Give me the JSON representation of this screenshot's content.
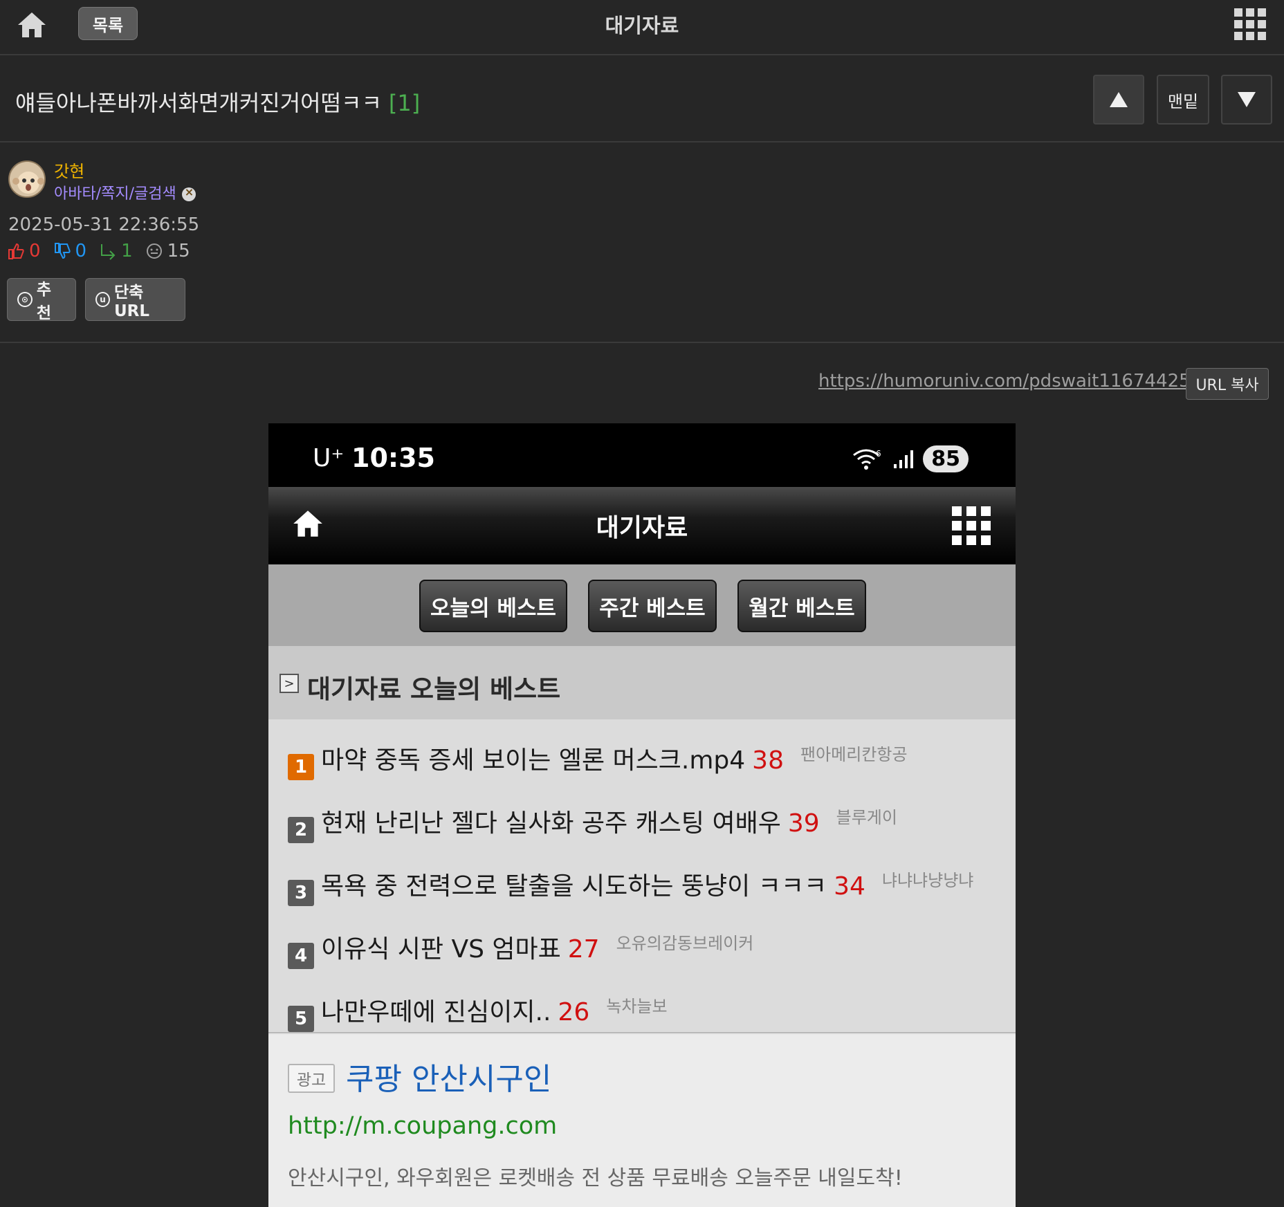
{
  "topbar": {
    "list_label": "목록",
    "title": "대기자료"
  },
  "post": {
    "title": "얘들아나폰바까서화면개커진거어떰ㅋㅋ",
    "comment_count": "[1]",
    "nav": {
      "up": "▲",
      "bottom": "맨밑",
      "down": "▼"
    }
  },
  "author": {
    "name": "갓현",
    "links": "아바타/쪽지/글검색",
    "date": "2025-05-31 22:36:55",
    "stats": {
      "likes": "0",
      "dislikes": "0",
      "replies": "1",
      "views": "15"
    },
    "recommend_label": "추천",
    "shorturl_label": "단축URL"
  },
  "url_row": {
    "url": "https://humoruniv.com/pdswait11674425",
    "copy_label": "URL 복사"
  },
  "screenshot": {
    "status": {
      "carrier": "U⁺",
      "time": "10:35",
      "battery": "85"
    },
    "header_title": "대기자료",
    "tabs": [
      "오늘의 베스트",
      "주간 베스트",
      "월간 베스트"
    ],
    "section_title": "대기자료 오늘의 베스트",
    "best": [
      {
        "rank": "1",
        "title": "마약 중독 증세 보이는 엘론 머스크.mp4",
        "count": "38",
        "nick": "팬아메리칸항공"
      },
      {
        "rank": "2",
        "title": "현재 난리난 젤다 실사화 공주 캐스팅 여배우",
        "count": "39",
        "nick": "블루게이"
      },
      {
        "rank": "3",
        "title": "목욕 중 전력으로 탈출을 시도하는 뚱냥이 ㅋㅋㅋ",
        "count": "34",
        "nick": "냐냐냐냥냥냐"
      },
      {
        "rank": "4",
        "title": "이유식 시판 VS 엄마표",
        "count": "27",
        "nick": "오유의감동브레이커"
      },
      {
        "rank": "5",
        "title": "나만우떼에 진심이지..",
        "count": "26",
        "nick": "녹차늘보"
      }
    ],
    "ad": {
      "tag": "광고",
      "title": "쿠팡 안산시구인",
      "url": "http://m.coupang.com",
      "desc": "안산시구인, 와우회원은 로켓배송 전 상품 무료배송 오늘주문 내일도착!"
    }
  },
  "colors": {
    "background": "#262626",
    "author_name": "#f0b400",
    "author_links": "#a48cff",
    "comment_count": "#4caf50",
    "best_count": "#d01010",
    "rank_first": "#e06a00",
    "ad_title": "#1a60b8",
    "ad_url": "#1f8a1f"
  }
}
